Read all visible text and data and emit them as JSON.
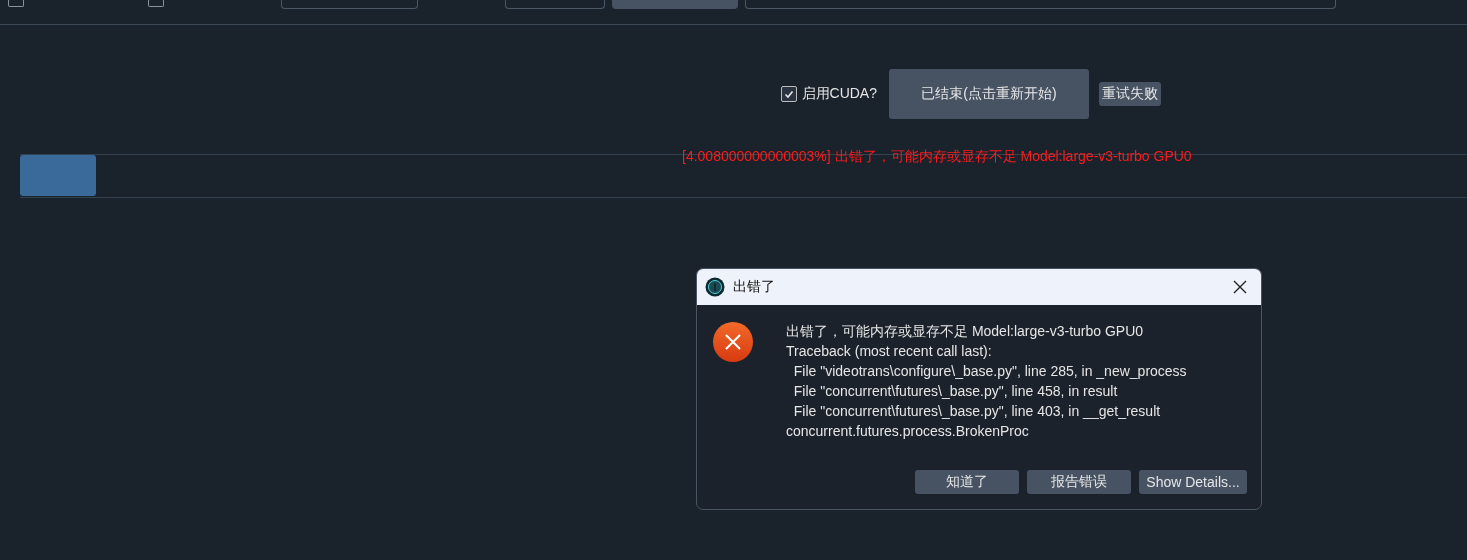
{
  "top_checkboxes": [
    {
      "checked": false
    },
    {
      "checked": false
    }
  ],
  "toolbar": {
    "cuda_checkbox": {
      "label": "启用CUDA?",
      "checked": true
    },
    "start_button": "已结束(点击重新开始)",
    "retry_button": "重试失败"
  },
  "task": {
    "progress_message": "[4.008000000000003%] 出错了，可能内存或显存不足 Model:large-v3-turbo GPU0"
  },
  "dialog": {
    "title": "出错了",
    "message_lines": [
      "出错了，可能内存或显存不足 Model:large-v3-turbo GPU0",
      "Traceback (most recent call last):",
      "  File \"videotrans\\configure\\_base.py\", line 285, in _new_process",
      "  File \"concurrent\\futures\\_base.py\", line 458, in result",
      "  File \"concurrent\\futures\\_base.py\", line 403, in __get_result",
      "concurrent.futures.process.BrokenProc"
    ],
    "buttons": [
      "知道了",
      "报告错误",
      "Show Details..."
    ]
  }
}
